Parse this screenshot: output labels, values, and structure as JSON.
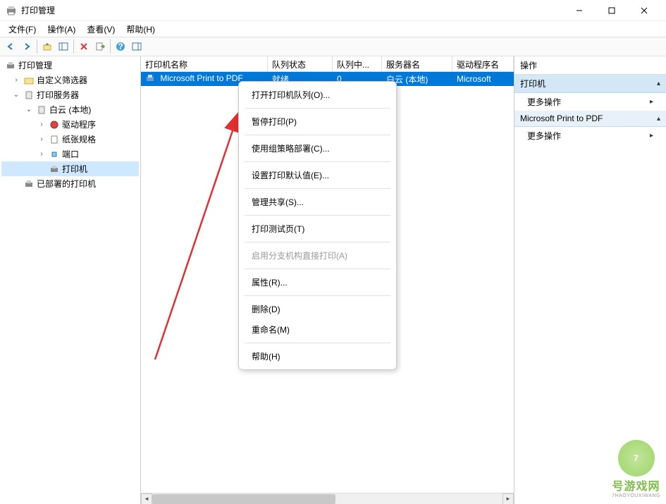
{
  "window": {
    "title": "打印管理"
  },
  "menubar": [
    {
      "label": "文件(F)"
    },
    {
      "label": "操作(A)"
    },
    {
      "label": "查看(V)"
    },
    {
      "label": "帮助(H)"
    }
  ],
  "tree": {
    "root": "打印管理",
    "custom_filter": "自定义筛选器",
    "print_servers": "打印服务器",
    "server_local": "白云 (本地)",
    "drivers": "驱动程序",
    "paper": "纸张规格",
    "ports": "端口",
    "printers": "打印机",
    "deployed": "已部署的打印机"
  },
  "list": {
    "columns": {
      "name": "打印机名称",
      "queue_status": "队列状态",
      "queue_count": "队列中...",
      "server_name": "服务器名",
      "driver_name": "驱动程序名"
    },
    "row": {
      "name": "Microsoft Print to PDF",
      "queue_status": "就绪",
      "queue_count": "0",
      "server_name": "白云 (本地)",
      "driver_name": "Microsoft"
    }
  },
  "actions": {
    "header": "操作",
    "printer_group": "打印机",
    "more_ops": "更多操作",
    "selected_group": "Microsoft Print to PDF"
  },
  "context_menu": {
    "open_queue": "打开打印机队列(O)...",
    "pause": "暂停打印(P)",
    "deploy_gpo": "使用组策略部署(C)...",
    "set_defaults": "设置打印默认值(E)...",
    "manage_sharing": "管理共享(S)...",
    "test_page": "打印测试页(T)",
    "enable_branch": "启用分支机构直接打印(A)",
    "properties": "属性(R)...",
    "delete": "删除(D)",
    "rename": "重命名(M)",
    "help": "帮助(H)"
  },
  "watermark": {
    "big": "7",
    "text": "号游戏网",
    "sub": "7HAOYOUXIWANG"
  }
}
